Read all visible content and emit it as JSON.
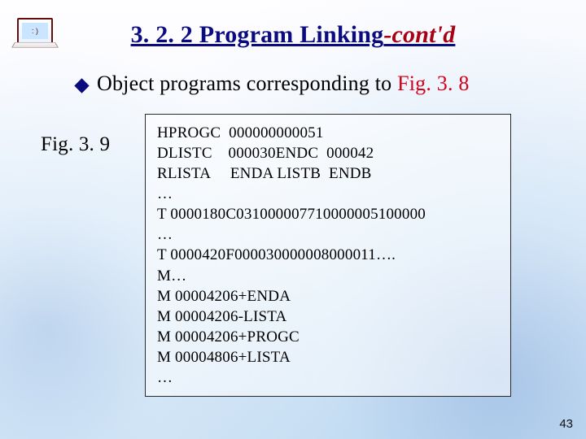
{
  "title": {
    "main": "3. 2. 2 Program Linking",
    "contd": "-cont'd"
  },
  "bullet": {
    "text_before": "Object programs corresponding to ",
    "figref": "Fig. 3. 8"
  },
  "fig_label": "Fig. 3. 9",
  "program": {
    "lines": [
      "HPROGC  000000000051",
      "DLISTC    000030ENDC  000042",
      "RLISTA     ENDA LISTB  ENDB",
      "…",
      "T 0000180C031000007710000005100000",
      "…",
      "T 0000420F000030000008000011….",
      "M…",
      "M 00004206+ENDA",
      "M 00004206-LISTA",
      "M 00004206+PROGC",
      "M 00004806+LISTA",
      "…"
    ]
  },
  "page_number": "43",
  "emblem_face": ": )"
}
